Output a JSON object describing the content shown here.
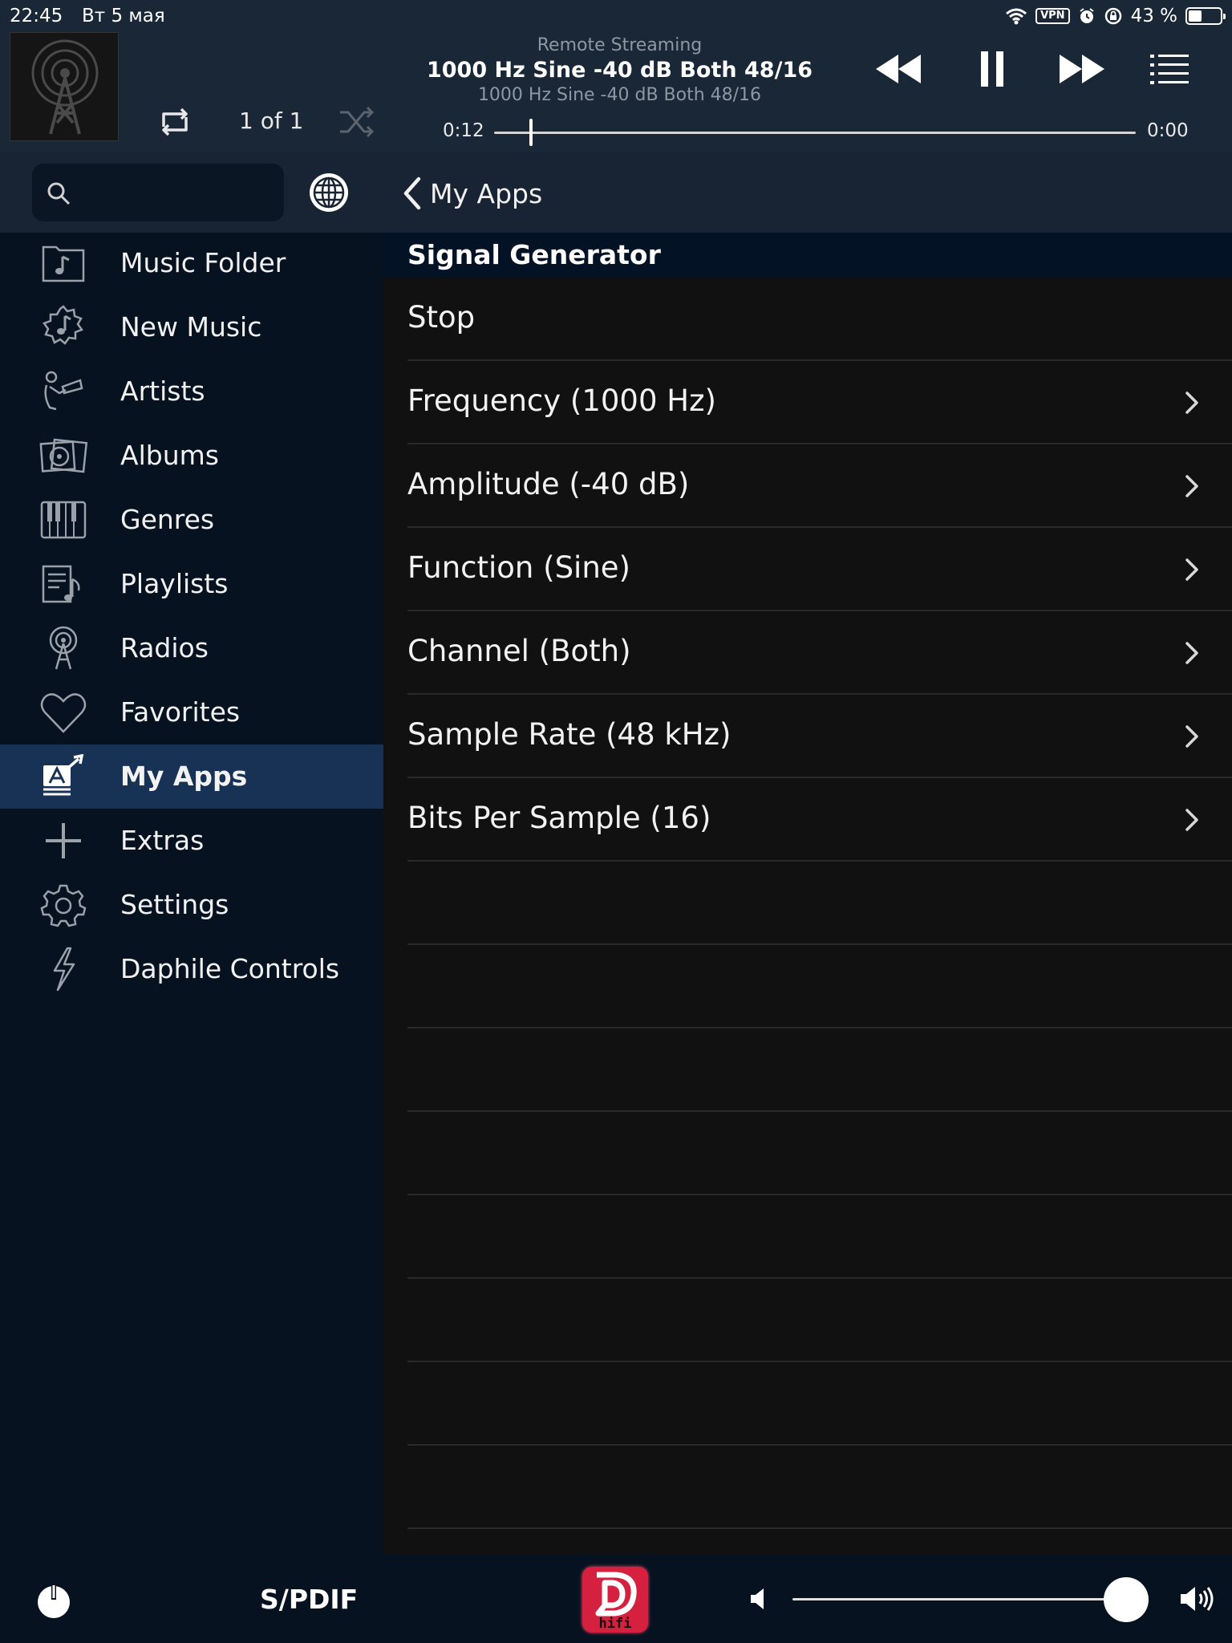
{
  "status_bar": {
    "time": "22:45",
    "date": "Вт 5 мая",
    "vpn": "VPN",
    "battery": "43 %",
    "battery_level": 0.43
  },
  "player": {
    "source": "Remote Streaming",
    "title": "1000 Hz Sine -40 dB Both 48/16",
    "subtitle": "1000 Hz Sine -40 dB Both 48/16",
    "track_count": "1 of 1",
    "elapsed": "0:12",
    "remaining": "0:00",
    "progress": 0.055,
    "state": "playing"
  },
  "sidebar": {
    "items": [
      {
        "label": "Music Folder",
        "icon": "music-folder-icon",
        "active": false
      },
      {
        "label": "New Music",
        "icon": "new-music-icon",
        "active": false
      },
      {
        "label": "Artists",
        "icon": "artists-icon",
        "active": false
      },
      {
        "label": "Albums",
        "icon": "albums-icon",
        "active": false
      },
      {
        "label": "Genres",
        "icon": "genres-icon",
        "active": false
      },
      {
        "label": "Playlists",
        "icon": "playlists-icon",
        "active": false
      },
      {
        "label": "Radios",
        "icon": "radios-icon",
        "active": false
      },
      {
        "label": "Favorites",
        "icon": "heart-icon",
        "active": false
      },
      {
        "label": "My Apps",
        "icon": "my-apps-icon",
        "active": true
      },
      {
        "label": "Extras",
        "icon": "plus-icon",
        "active": false
      },
      {
        "label": "Settings",
        "icon": "gear-icon",
        "active": false
      },
      {
        "label": "Daphile Controls",
        "icon": "lightning-icon",
        "active": false
      }
    ]
  },
  "main": {
    "back_label": "My Apps",
    "section_title": "Signal Generator",
    "rows": [
      {
        "label": "Stop",
        "has_chevron": false
      },
      {
        "label": "Frequency (1000 Hz)",
        "has_chevron": true
      },
      {
        "label": "Amplitude (-40 dB)",
        "has_chevron": true
      },
      {
        "label": "Function (Sine)",
        "has_chevron": true
      },
      {
        "label": "Channel (Both)",
        "has_chevron": true
      },
      {
        "label": "Sample Rate (48 kHz)",
        "has_chevron": true
      },
      {
        "label": "Bits Per Sample (16)",
        "has_chevron": true
      }
    ]
  },
  "bottom_bar": {
    "output": "S/PDIF",
    "logo_text": "hifi",
    "volume": 0.95
  },
  "colors": {
    "sidebar_bg": "#061220",
    "header_bg": "#182433",
    "active_item_bg": "#173254",
    "content_bg": "#111111",
    "logo_red": "#d6203f"
  }
}
